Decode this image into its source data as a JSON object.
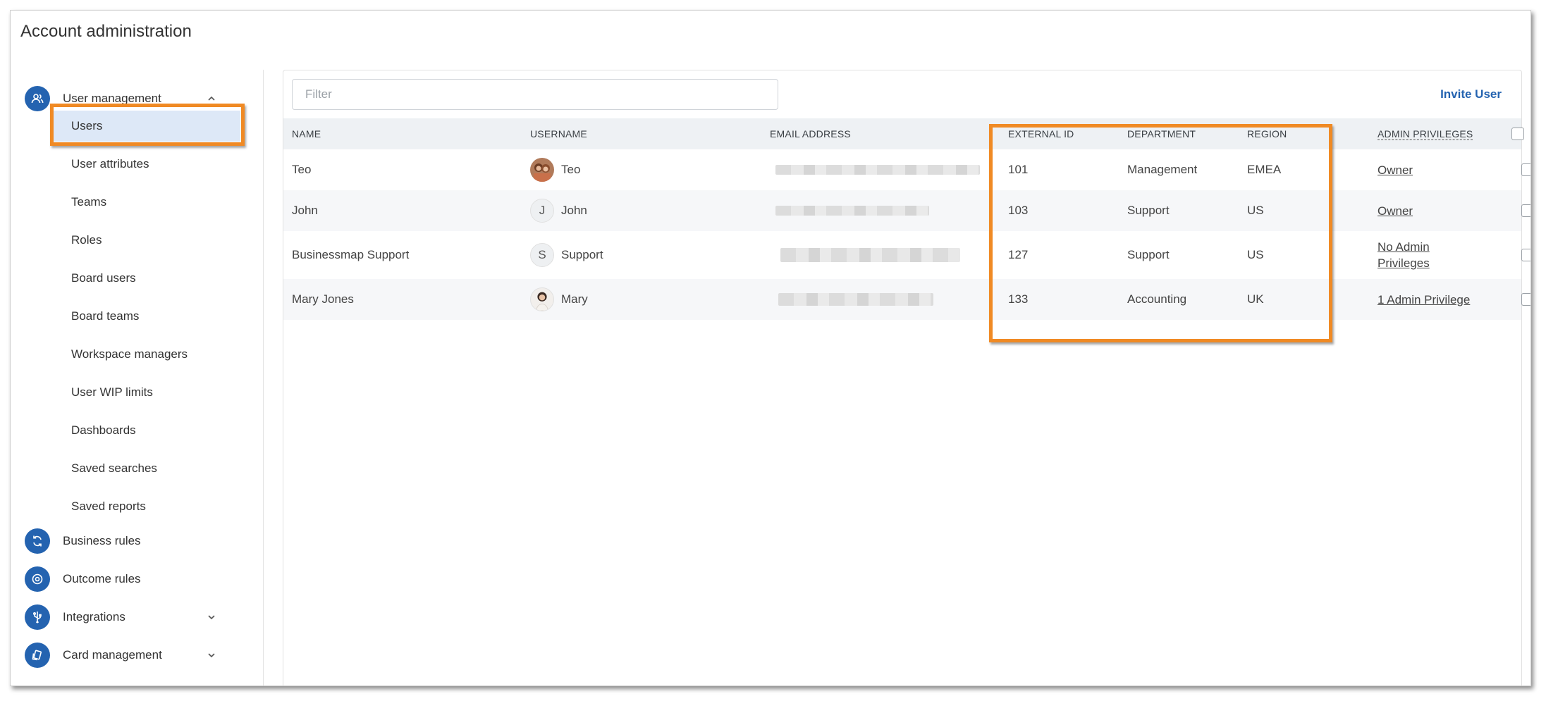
{
  "page": {
    "title": "Account administration"
  },
  "colors": {
    "accent": "#2463b0",
    "highlight": "#f08a24",
    "active_bg": "#dde8f7"
  },
  "sidebar": {
    "user_management": {
      "label": "User management",
      "icon": "users-icon"
    },
    "items": [
      {
        "label": "Users"
      },
      {
        "label": "User attributes"
      },
      {
        "label": "Teams"
      },
      {
        "label": "Roles"
      },
      {
        "label": "Board users"
      },
      {
        "label": "Board teams"
      },
      {
        "label": "Workspace managers"
      },
      {
        "label": "User WIP limits"
      },
      {
        "label": "Dashboards"
      },
      {
        "label": "Saved searches"
      },
      {
        "label": "Saved reports"
      }
    ],
    "groups": [
      {
        "label": "Business rules",
        "icon": "refresh-icon"
      },
      {
        "label": "Outcome rules",
        "icon": "target-icon"
      },
      {
        "label": "Integrations",
        "icon": "usb-icon"
      },
      {
        "label": "Card management",
        "icon": "cards-icon"
      }
    ]
  },
  "toolbar": {
    "filter_placeholder": "Filter",
    "invite_label": "Invite User"
  },
  "table": {
    "headers": {
      "name": "NAME",
      "username": "USERNAME",
      "email": "EMAIL ADDRESS",
      "external_id": "EXTERNAL ID",
      "department": "DEPARTMENT",
      "region": "REGION",
      "admin": "ADMIN PRIVILEGES"
    },
    "rows": [
      {
        "name": "Teo",
        "avatar": "photo",
        "username": "Teo",
        "external_id": "101",
        "department": "Management",
        "region": "EMEA",
        "admin_1": "Owner",
        "admin_2": ""
      },
      {
        "name": "John",
        "avatar": "J",
        "username": "John",
        "external_id": "103",
        "department": "Support",
        "region": "US",
        "admin_1": "Owner",
        "admin_2": ""
      },
      {
        "name": "Businessmap Support",
        "avatar": "S",
        "username": "Support",
        "external_id": "127",
        "department": "Support",
        "region": "US",
        "admin_1": "No Admin",
        "admin_2": "Privileges"
      },
      {
        "name": "Mary Jones",
        "avatar": "photo",
        "username": "Mary",
        "external_id": "133",
        "department": "Accounting",
        "region": "UK",
        "admin_1": "1 Admin Privilege",
        "admin_2": ""
      }
    ]
  }
}
